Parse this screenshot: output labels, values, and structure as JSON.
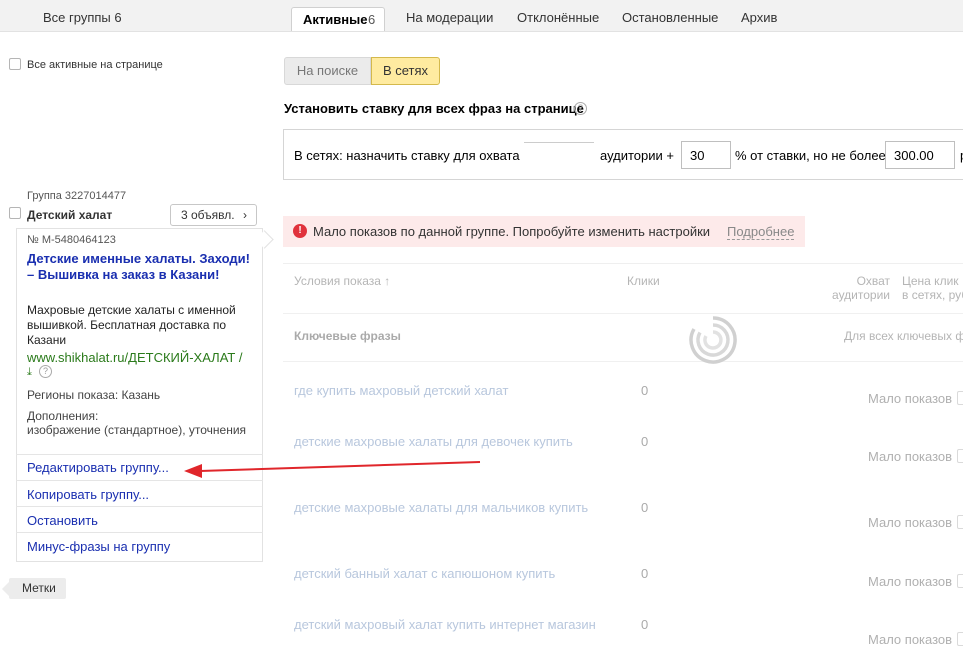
{
  "tabs": {
    "all_groups": "Все группы 6",
    "active_label": "Активные",
    "active_count": "6",
    "moderation": "На модерации",
    "rejected": "Отклонённые",
    "stopped": "Остановленные",
    "archive": "Архив"
  },
  "select_all_label": "Все активные на странице",
  "switch": {
    "search": "На поиске",
    "networks": "В сетях"
  },
  "rate": {
    "title": "Установить ставку для всех фраз на странице",
    "help_icon": "question-icon",
    "prefix": "В сетях:  назначить ставку для охвата",
    "audience": "аудитории +",
    "percent_value": "30",
    "percent_text": "% от ставки, но не более",
    "max_value": "300.00",
    "currency": "р"
  },
  "warning": {
    "text": "Мало показов по данной группе. Попробуйте изменить настройки",
    "link": "Подробнее",
    "color": "#e0323c"
  },
  "table": {
    "col_conditions": "Условия показа ↑",
    "col_clicks": "Клики",
    "col_reach_1": "Охват",
    "col_reach_2": "аудитории",
    "col_price_1": "Цена клик",
    "col_price_2": "в сетях, руб",
    "section_title": "Ключевые фразы",
    "section_all": "Для всех ключевых ф",
    "rows": [
      {
        "phrase": "где купить махровый детский халат",
        "clicks": "0",
        "reach": "Мало показов"
      },
      {
        "phrase": "детские махровые халаты для девочек купить",
        "clicks": "0",
        "reach": "Мало показов"
      },
      {
        "phrase": "детские махровые халаты для мальчиков купить",
        "clicks": "0",
        "reach": "Мало показов"
      },
      {
        "phrase": "детский банный халат с капюшоном купить",
        "clicks": "0",
        "reach": "Мало показов"
      },
      {
        "phrase": "детский махровый халат купить интернет магазин",
        "clicks": "0",
        "reach": "Мало показов"
      }
    ]
  },
  "group": {
    "id": "Группа 3227014477",
    "name": "Детский халат",
    "ads_button": "3 объявл.",
    "ad_number": "№ М-5480464123",
    "ad_title": "Детские именные халаты. Заходи! – Вышивка на заказ в Казани!",
    "ad_text": "Махровые детские халаты с именной вышивкой. Бесплатная доставка по Казани",
    "ad_url": "www.shikhalat.ru/ДЕТСКИЙ-ХАЛАТ /",
    "vcard_icon": "download-arrow-icon",
    "regions": "Регионы показа: Казань",
    "extensions_label": "Дополнения:",
    "extensions": "изображение (стандартное), уточнения",
    "actions": {
      "edit": "Редактировать группу...",
      "copy": "Копировать группу...",
      "stop": "Остановить",
      "minus": "Минус-фразы на группу"
    }
  },
  "tags_label": "Метки",
  "arrow_color": "#e0262b"
}
